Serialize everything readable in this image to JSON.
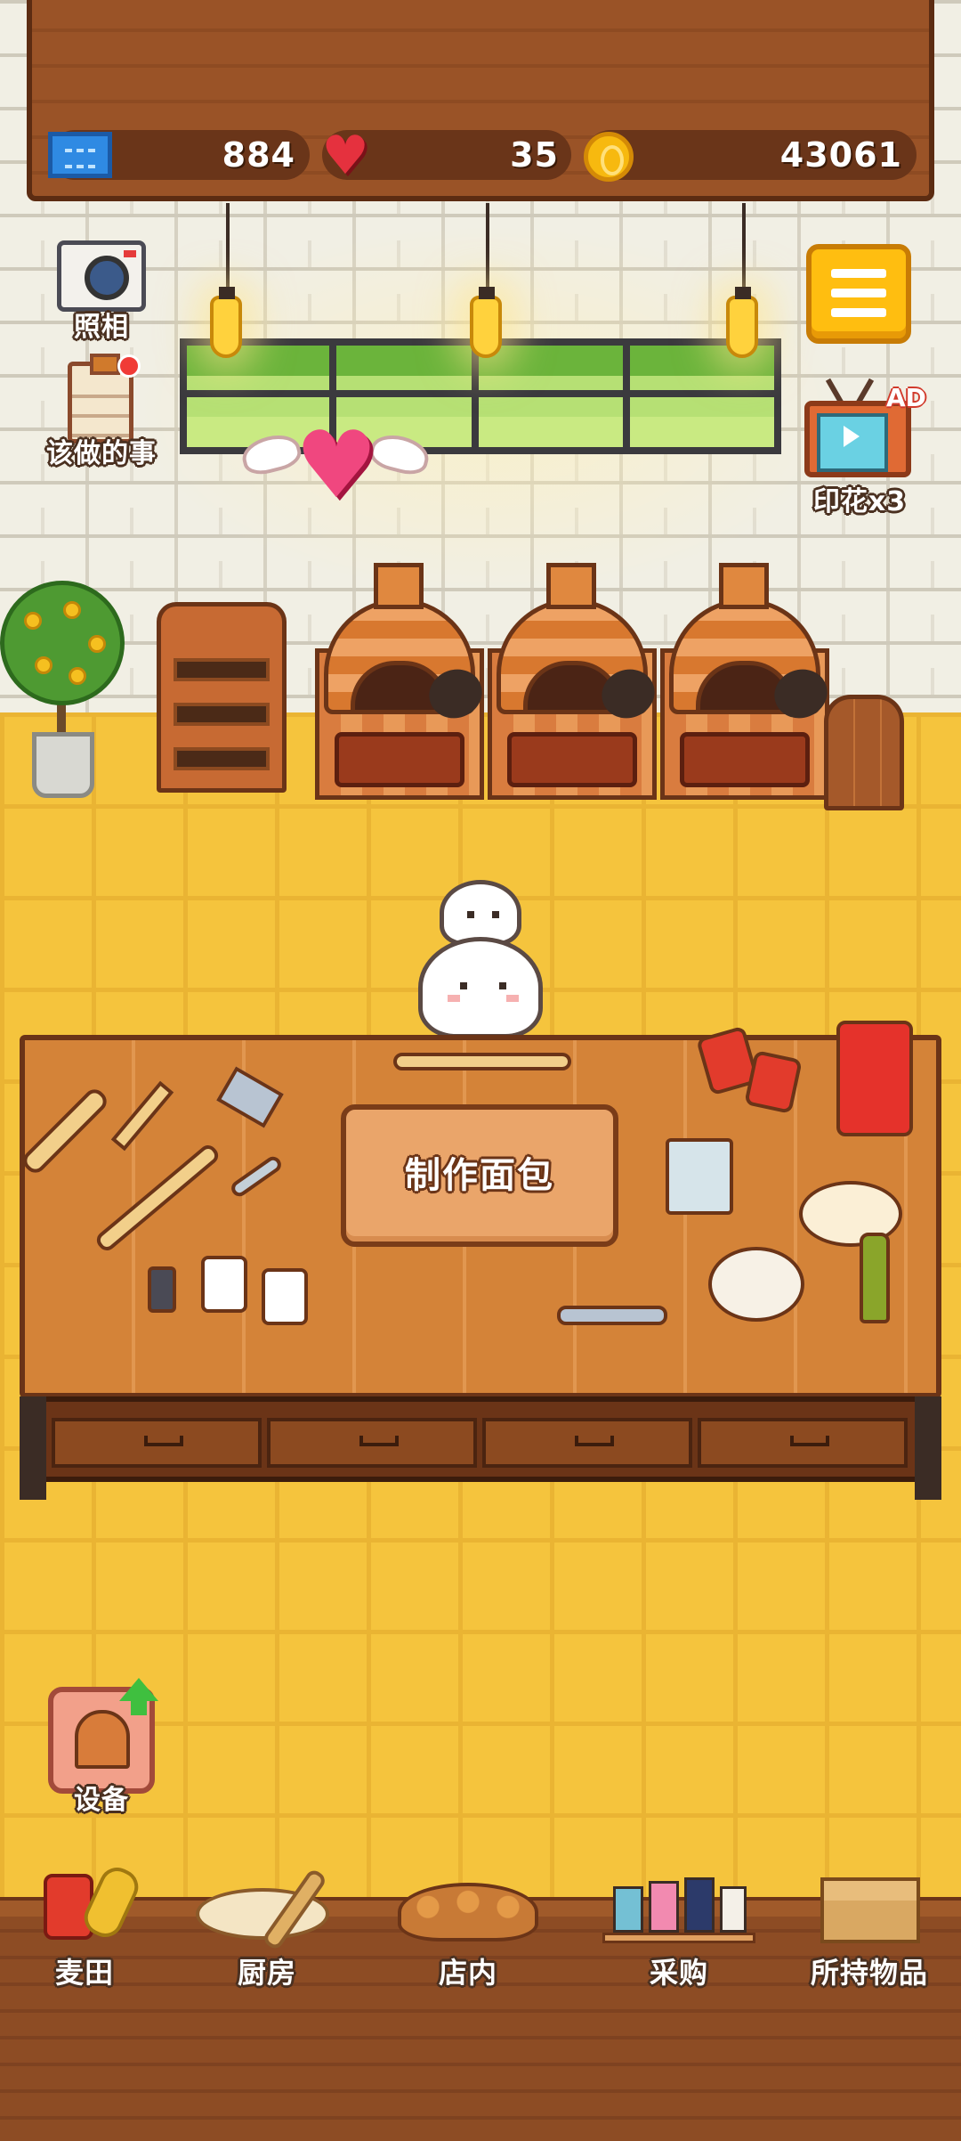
{
  "currency": {
    "tickets": "884",
    "hearts": "35",
    "coins": "43061"
  },
  "side_buttons": {
    "camera_label": "照相",
    "todo_label": "该做的事",
    "ad_badge": "AD",
    "stamp_label": "印花x3"
  },
  "workbench": {
    "make_bread_label": "制作面包"
  },
  "equipment": {
    "label": "设备"
  },
  "nav": [
    {
      "label": "麦田",
      "icon": "wheat-field-icon"
    },
    {
      "label": "厨房",
      "icon": "kitchen-icon"
    },
    {
      "label": "店内",
      "icon": "store-icon"
    },
    {
      "label": "采购",
      "icon": "shopping-icon"
    },
    {
      "label": "所持物品",
      "icon": "inventory-box-icon"
    }
  ],
  "colors": {
    "header_wood": "#9a5327",
    "floor_yellow": "#f5c43d",
    "menu_orange": "#ffbe10",
    "heart_red": "#e5313e",
    "coin_gold": "#f7b90f"
  }
}
